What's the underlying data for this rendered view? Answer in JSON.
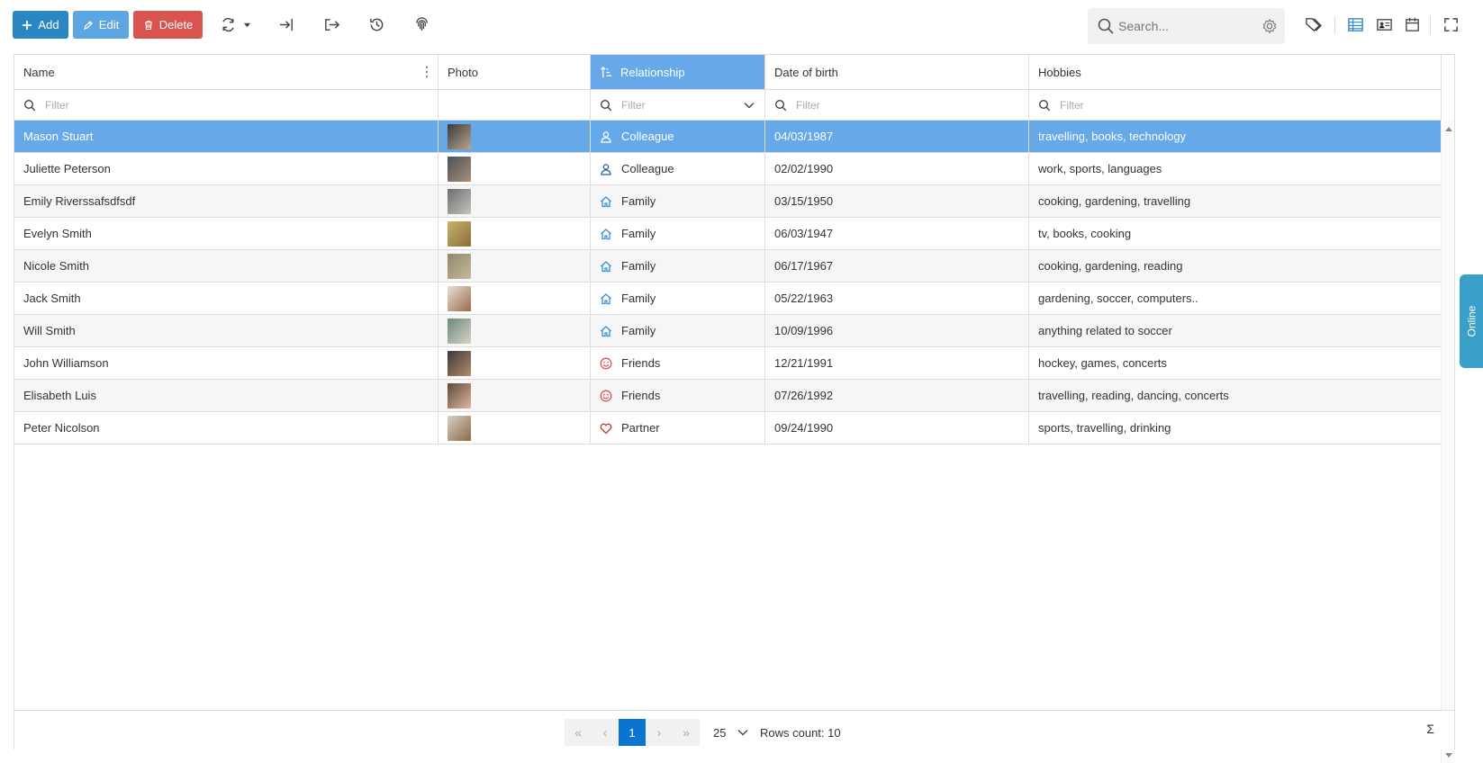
{
  "toolbar": {
    "add_label": "Add",
    "edit_label": "Edit",
    "delete_label": "Delete",
    "search_placeholder": "Search..."
  },
  "columns": [
    "Name",
    "Photo",
    "Relationship",
    "Date of birth",
    "Hobbies"
  ],
  "sorted_column": "Relationship",
  "filter_placeholder": "Filter",
  "rows": [
    {
      "name": "Mason Stuart",
      "relationship": "Colleague",
      "rel_icon": "user-icon",
      "dob": "04/03/1987",
      "hobbies": "travelling, books, technology",
      "selected": true
    },
    {
      "name": "Juliette Peterson",
      "relationship": "Colleague",
      "rel_icon": "user-icon",
      "dob": "02/02/1990",
      "hobbies": "work, sports, languages"
    },
    {
      "name": "Emily Riverssafsdfsdf",
      "relationship": "Family",
      "rel_icon": "home-icon",
      "dob": "03/15/1950",
      "hobbies": "cooking, gardening, travelling"
    },
    {
      "name": "Evelyn Smith",
      "relationship": "Family",
      "rel_icon": "home-icon",
      "dob": "06/03/1947",
      "hobbies": "tv, books, cooking"
    },
    {
      "name": "Nicole Smith",
      "relationship": "Family",
      "rel_icon": "home-icon",
      "dob": "06/17/1967",
      "hobbies": "cooking, gardening, reading"
    },
    {
      "name": "Jack Smith",
      "relationship": "Family",
      "rel_icon": "home-icon",
      "dob": "05/22/1963",
      "hobbies": "gardening, soccer, computers.."
    },
    {
      "name": "Will Smith",
      "relationship": "Family",
      "rel_icon": "home-icon",
      "dob": "10/09/1996",
      "hobbies": "anything related to soccer"
    },
    {
      "name": "John Williamson",
      "relationship": "Friends",
      "rel_icon": "smile-icon",
      "dob": "12/21/1991",
      "hobbies": "hockey, games, concerts"
    },
    {
      "name": "Elisabeth Luis",
      "relationship": "Friends",
      "rel_icon": "smile-icon",
      "dob": "07/26/1992",
      "hobbies": "travelling, reading, dancing, concerts"
    },
    {
      "name": "Peter Nicolson",
      "relationship": "Partner",
      "rel_icon": "heart-icon",
      "dob": "09/24/1990",
      "hobbies": "sports, travelling, drinking"
    }
  ],
  "pager": {
    "current_page": "1",
    "page_size": "25",
    "rows_count": "Rows count: 10",
    "sigma": "Σ"
  },
  "online_tab": "Online",
  "colors": {
    "add": "#2b87c4",
    "edit": "#5ea5e3",
    "delete": "#d9534f",
    "selected_row": "#66a8e8",
    "active_page": "#0a75d1",
    "online_tab": "#3a9fc9",
    "icon_colleague": "#2a5d9f",
    "icon_family": "#3a8fd9",
    "icon_friends": "#d9534f",
    "icon_partner": "#c0392b"
  }
}
